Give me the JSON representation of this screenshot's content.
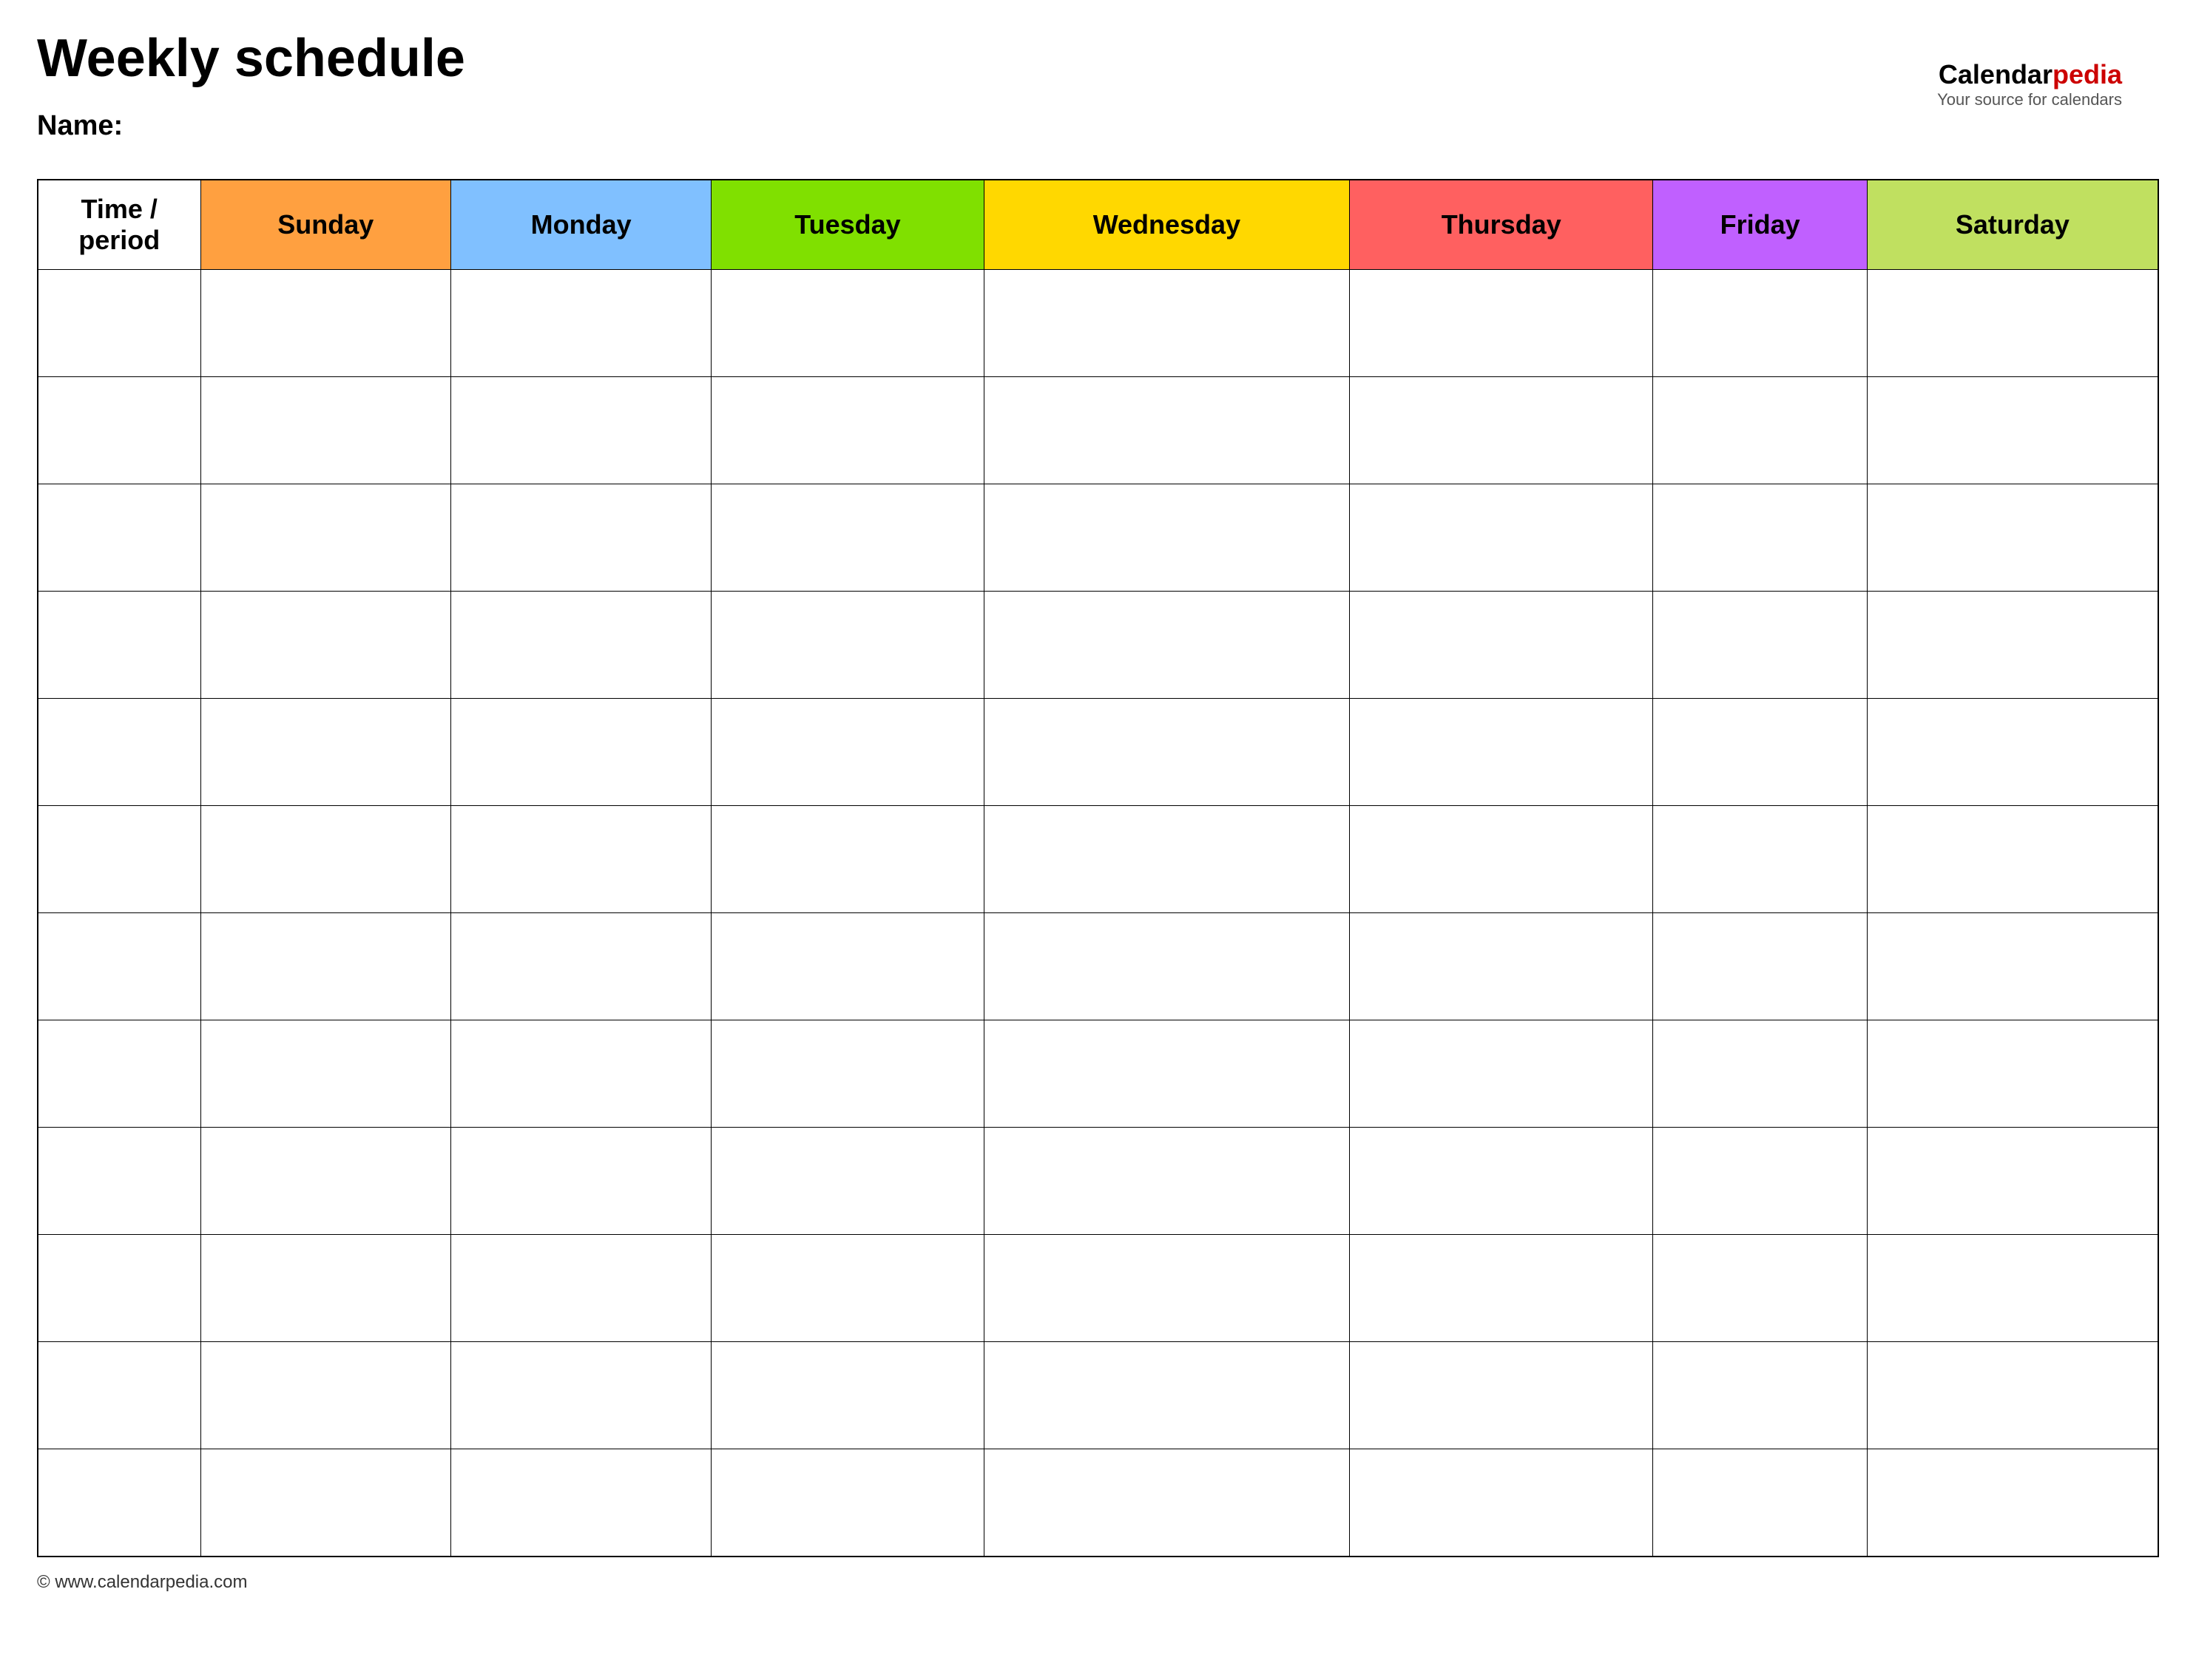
{
  "page": {
    "title": "Weekly schedule",
    "name_label": "Name:",
    "footer_text": "© www.calendarpedia.com"
  },
  "logo": {
    "calendar_text": "Calendar",
    "pedia_text": "pedia",
    "tagline": "Your source for calendars"
  },
  "table": {
    "headers": [
      {
        "key": "time",
        "label": "Time / period",
        "class": "th-time"
      },
      {
        "key": "sunday",
        "label": "Sunday",
        "class": "th-sunday"
      },
      {
        "key": "monday",
        "label": "Monday",
        "class": "th-monday"
      },
      {
        "key": "tuesday",
        "label": "Tuesday",
        "class": "th-tuesday"
      },
      {
        "key": "wednesday",
        "label": "Wednesday",
        "class": "th-wednesday"
      },
      {
        "key": "thursday",
        "label": "Thursday",
        "class": "th-thursday"
      },
      {
        "key": "friday",
        "label": "Friday",
        "class": "th-friday"
      },
      {
        "key": "saturday",
        "label": "Saturday",
        "class": "th-saturday"
      }
    ],
    "row_count": 12
  }
}
